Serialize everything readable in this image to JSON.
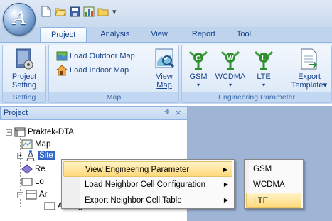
{
  "app": {
    "orb_glyph": "A"
  },
  "quick_access": [
    {
      "icon": "new-document-icon"
    },
    {
      "icon": "open-folder-icon"
    },
    {
      "icon": "save-icon"
    },
    {
      "icon": "chart-icon"
    },
    {
      "icon": "folder-icon"
    }
  ],
  "quick_access_more": "▾",
  "tabs": [
    "Project",
    "Analysis",
    "View",
    "Report",
    "Tool"
  ],
  "active_tab": "Project",
  "ribbon": {
    "setting_group": {
      "label": "Setting",
      "project_setting": [
        "Project",
        "Setting"
      ]
    },
    "map_group": {
      "label": "Map",
      "load_outdoor": "Load Outdoor Map",
      "load_indoor": "Load Indoor Map",
      "view_map": [
        "View",
        "Map"
      ]
    },
    "eng_group": {
      "label": "Engineering Parameter",
      "gsm": "GSM",
      "wcdma": "WCDMA",
      "lte": "LTE",
      "export_template": [
        "Export",
        "Template"
      ]
    }
  },
  "panel": {
    "title": "Project",
    "pin": "ᵖ",
    "close": "×"
  },
  "tree": {
    "root": "Praktek-DTA",
    "map": "Map",
    "site": "Site",
    "re_partial": "Re",
    "lo_partial": "Lo",
    "ar_partial": "Ar",
    "all_logs": "All Logs"
  },
  "context_menu": {
    "items": [
      {
        "label": "View Engineering Parameter",
        "highlight": true
      },
      {
        "label": "Load Neighbor Cell Configuration",
        "highlight": false
      },
      {
        "label": "Export Neighbor Cell Table",
        "highlight": false
      }
    ]
  },
  "submenu": {
    "items": [
      {
        "label": "GSM",
        "highlight": false
      },
      {
        "label": "WCDMA",
        "highlight": false
      },
      {
        "label": "LTE",
        "highlight": true
      }
    ]
  },
  "colors": {
    "accent": "#15428b",
    "workspace": "#9eb5d6",
    "highlight": "#ffd978"
  }
}
